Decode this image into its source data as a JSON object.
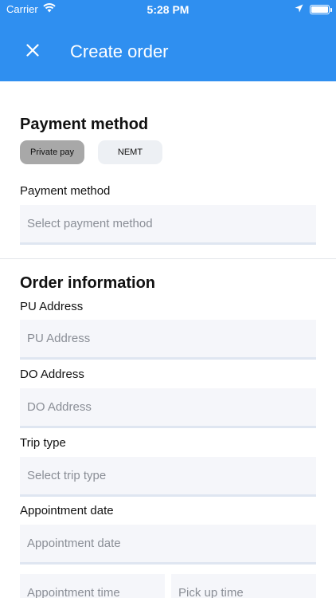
{
  "status_bar": {
    "carrier": "Carrier",
    "time": "5:28 PM"
  },
  "header": {
    "title": "Create order",
    "close_icon": "close-icon"
  },
  "payment": {
    "section_title": "Payment method",
    "options": [
      "Private pay",
      "NEMT"
    ],
    "selected_option": "Private pay",
    "method_label": "Payment method",
    "method_placeholder": "Select payment method"
  },
  "order": {
    "section_title": "Order information",
    "pu_label": "PU Address",
    "pu_placeholder": "PU Address",
    "do_label": "DO Address",
    "do_placeholder": "DO Address",
    "trip_label": "Trip type",
    "trip_placeholder": "Select trip type",
    "appt_label": "Appointment date",
    "appt_placeholder": "Appointment date",
    "appt_time_placeholder": "Appointment time",
    "pickup_time_placeholder": "Pick up time"
  },
  "colors": {
    "accent": "#2f8ff0",
    "selected_pill": "#a8a8a8",
    "field_bg": "#f5f6fa"
  }
}
